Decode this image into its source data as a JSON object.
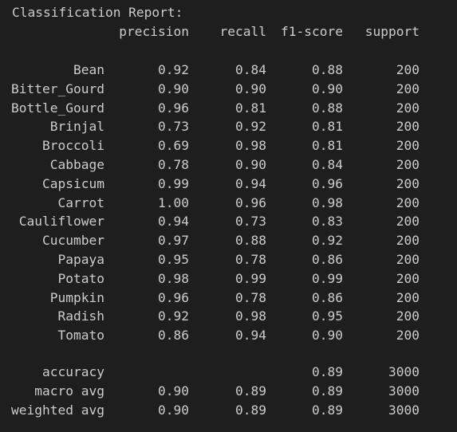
{
  "report": {
    "title": "Classification Report:",
    "headers": {
      "precision": "precision",
      "recall": "recall",
      "f1": "f1-score",
      "support": "support"
    },
    "rows": [
      {
        "label": "Bean",
        "precision": "0.92",
        "recall": "0.84",
        "f1": "0.88",
        "support": "200"
      },
      {
        "label": "Bitter_Gourd",
        "precision": "0.90",
        "recall": "0.90",
        "f1": "0.90",
        "support": "200"
      },
      {
        "label": "Bottle_Gourd",
        "precision": "0.96",
        "recall": "0.81",
        "f1": "0.88",
        "support": "200"
      },
      {
        "label": "Brinjal",
        "precision": "0.73",
        "recall": "0.92",
        "f1": "0.81",
        "support": "200"
      },
      {
        "label": "Broccoli",
        "precision": "0.69",
        "recall": "0.98",
        "f1": "0.81",
        "support": "200"
      },
      {
        "label": "Cabbage",
        "precision": "0.78",
        "recall": "0.90",
        "f1": "0.84",
        "support": "200"
      },
      {
        "label": "Capsicum",
        "precision": "0.99",
        "recall": "0.94",
        "f1": "0.96",
        "support": "200"
      },
      {
        "label": "Carrot",
        "precision": "1.00",
        "recall": "0.96",
        "f1": "0.98",
        "support": "200"
      },
      {
        "label": "Cauliflower",
        "precision": "0.94",
        "recall": "0.73",
        "f1": "0.83",
        "support": "200"
      },
      {
        "label": "Cucumber",
        "precision": "0.97",
        "recall": "0.88",
        "f1": "0.92",
        "support": "200"
      },
      {
        "label": "Papaya",
        "precision": "0.95",
        "recall": "0.78",
        "f1": "0.86",
        "support": "200"
      },
      {
        "label": "Potato",
        "precision": "0.98",
        "recall": "0.99",
        "f1": "0.99",
        "support": "200"
      },
      {
        "label": "Pumpkin",
        "precision": "0.96",
        "recall": "0.78",
        "f1": "0.86",
        "support": "200"
      },
      {
        "label": "Radish",
        "precision": "0.92",
        "recall": "0.98",
        "f1": "0.95",
        "support": "200"
      },
      {
        "label": "Tomato",
        "precision": "0.86",
        "recall": "0.94",
        "f1": "0.90",
        "support": "200"
      }
    ],
    "summary": [
      {
        "label": "accuracy",
        "precision": "",
        "recall": "",
        "f1": "0.89",
        "support": "3000"
      },
      {
        "label": "macro avg",
        "precision": "0.90",
        "recall": "0.89",
        "f1": "0.89",
        "support": "3000"
      },
      {
        "label": "weighted avg",
        "precision": "0.90",
        "recall": "0.89",
        "f1": "0.89",
        "support": "3000"
      }
    ]
  }
}
